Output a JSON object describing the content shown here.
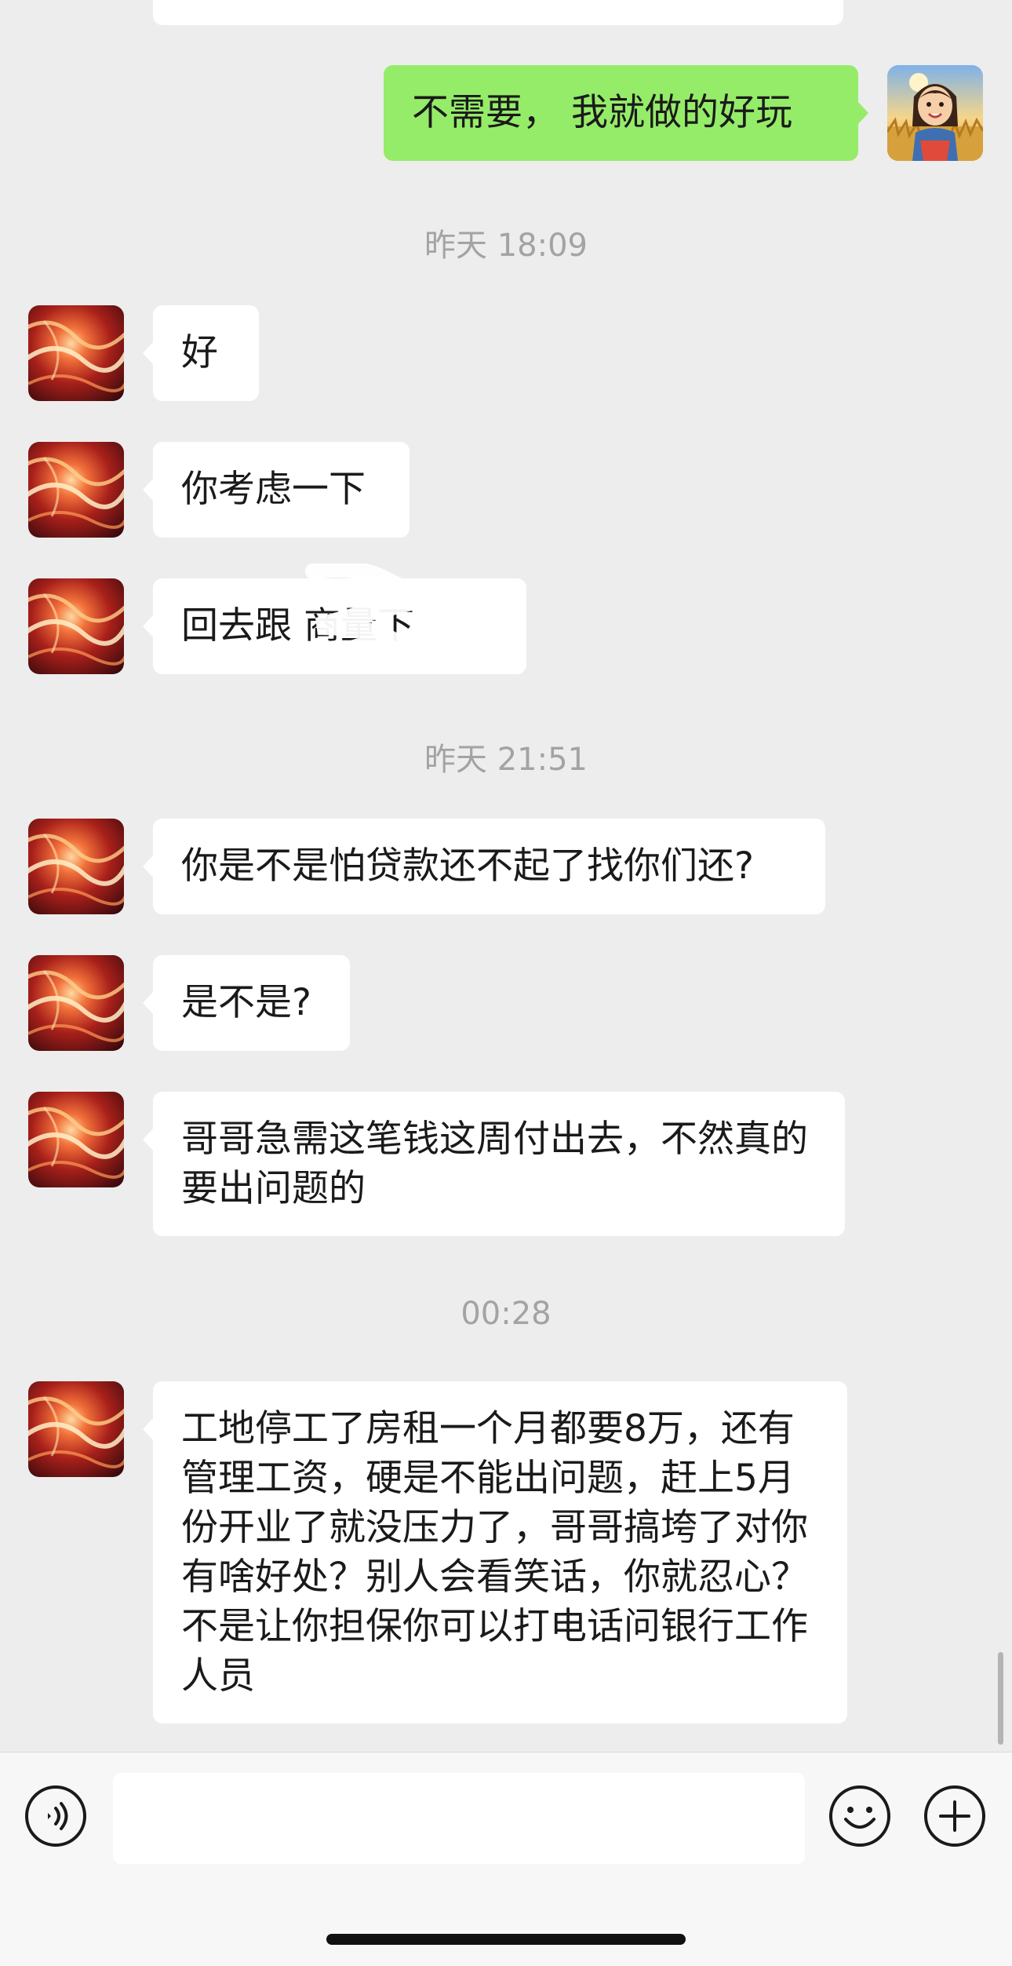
{
  "conversation": {
    "outgoing": [
      {
        "text": "不需要， 我就做的好玩",
        "avatar": "girl-in-wheat-field-avatar"
      }
    ],
    "timestamps": [
      "昨天 18:09",
      "昨天 21:51",
      "00:28"
    ],
    "incoming": [
      {
        "text": "好",
        "avatar": "red-abstract-avatar"
      },
      {
        "text": "你考虑一下",
        "avatar": "red-abstract-avatar"
      },
      {
        "text": "回去跟 商量下",
        "avatar": "red-abstract-avatar",
        "redacted": true
      },
      {
        "text": "你是不是怕贷款还不起了找你们还?",
        "avatar": "red-abstract-avatar"
      },
      {
        "text": "是不是?",
        "avatar": "red-abstract-avatar"
      },
      {
        "text": "哥哥急需这笔钱这周付出去，不然真的要出问题的",
        "avatar": "red-abstract-avatar"
      },
      {
        "text": "工地停工了房租一个月都要8万，还有管理工资，硬是不能出问题，赶上5月份开业了就没压力了，哥哥搞垮了对你有啥好处？别人会看笑话，你就忍心？不是让你担保你可以打电话问银行工作人员",
        "avatar": "red-abstract-avatar"
      }
    ]
  },
  "input_bar": {
    "value": "",
    "icons": [
      "voice-icon",
      "emoji-icon",
      "plus-icon"
    ]
  },
  "colors": {
    "background": "#ededed",
    "outgoing_bubble": "#95ec69",
    "incoming_bubble": "#ffffff",
    "timestamp_text": "#a3a3a3",
    "input_bar": "#f7f7f7"
  }
}
